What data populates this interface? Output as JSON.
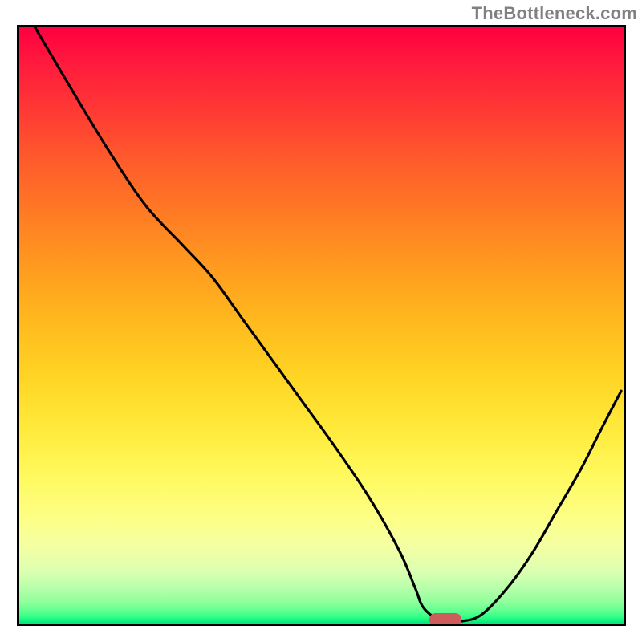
{
  "watermark": "TheBottleneck.com",
  "chart_data": {
    "type": "line",
    "title": "",
    "xlabel": "",
    "ylabel": "",
    "xlim": [
      0,
      100
    ],
    "ylim": [
      0,
      100
    ],
    "grid": false,
    "background": "red-yellow-green vertical gradient",
    "series": [
      {
        "name": "curve",
        "color": "#000000",
        "x": [
          2.6,
          9.0,
          15.0,
          21.0,
          27.0,
          32.0,
          37.0,
          42.0,
          47.0,
          52.0,
          58.0,
          63.0,
          65.5,
          67.0,
          70.0,
          73.2,
          76.5,
          80.8,
          85.0,
          89.0,
          93.0,
          96.0,
          99.6
        ],
        "y": [
          100.0,
          89.0,
          79.0,
          70.0,
          63.5,
          58.0,
          51.0,
          44.0,
          37.0,
          30.0,
          21.0,
          12.0,
          6.0,
          2.5,
          0.4,
          0.4,
          1.5,
          6.0,
          12.0,
          19.0,
          26.0,
          32.0,
          39.0
        ]
      }
    ],
    "marker": {
      "shape": "rounded-rect",
      "color": "#cd5c5c",
      "x": 70.5,
      "y": 0.7,
      "w": 5.3,
      "h": 2.1
    }
  }
}
